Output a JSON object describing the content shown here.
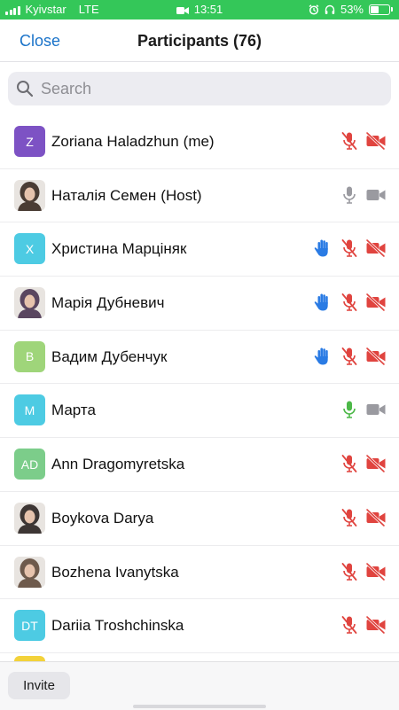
{
  "status_bar": {
    "carrier": "Kyivstar",
    "network": "LTE",
    "time": "13:51",
    "battery": "53%",
    "battery_level": 0.53,
    "icons": [
      "signal-icon",
      "camera-icon",
      "alarm-icon",
      "headphones-icon",
      "battery-icon"
    ]
  },
  "header": {
    "close_label": "Close",
    "title": "Participants (76)"
  },
  "search": {
    "placeholder": "Search"
  },
  "colors": {
    "accent": "#1a73c9",
    "status_bar": "#34c759",
    "muted_red": "#e0443f",
    "mic_active_green": "#4cb848",
    "raised_hand_blue": "#2a7be4",
    "neutral_gray": "#9a9aa0"
  },
  "participants": [
    {
      "name": "Zoriana Haladzhun",
      "role": "(me)",
      "avatar_text": "Z",
      "avatar_color": "#7d52c4",
      "photo": false,
      "hand": false,
      "mic": "muted",
      "video": "off"
    },
    {
      "name": "Наталія Семен",
      "role": "(Host)",
      "avatar_text": "",
      "avatar_color": "#4a3c34",
      "photo": true,
      "hand": false,
      "mic": "idle",
      "video": "idle"
    },
    {
      "name": "Христина Марціняк",
      "role": "",
      "avatar_text": "X",
      "avatar_color": "#4dcbe3",
      "photo": false,
      "hand": true,
      "mic": "muted",
      "video": "off"
    },
    {
      "name": "Марія Дубневич",
      "role": "",
      "avatar_text": "",
      "avatar_color": "#5a4660",
      "photo": true,
      "hand": true,
      "mic": "muted",
      "video": "off"
    },
    {
      "name": "Вадим Дубенчук",
      "role": "",
      "avatar_text": "B",
      "avatar_color": "#9fd57a",
      "photo": false,
      "hand": true,
      "mic": "muted",
      "video": "off"
    },
    {
      "name": "Марта",
      "role": "",
      "avatar_text": "M",
      "avatar_color": "#4dcbe3",
      "photo": false,
      "hand": false,
      "mic": "active",
      "video": "idle"
    },
    {
      "name": "Ann Dragomyretska",
      "role": "",
      "avatar_text": "AD",
      "avatar_color": "#7ccd8a",
      "photo": false,
      "hand": false,
      "mic": "muted",
      "video": "off"
    },
    {
      "name": "Boykova Darya",
      "role": "",
      "avatar_text": "",
      "avatar_color": "#3d3634",
      "photo": true,
      "hand": false,
      "mic": "muted",
      "video": "off"
    },
    {
      "name": "Bozhena Ivanytska",
      "role": "",
      "avatar_text": "",
      "avatar_color": "#6e5a4c",
      "photo": true,
      "hand": false,
      "mic": "muted",
      "video": "off"
    },
    {
      "name": "Dariia Troshchinska",
      "role": "",
      "avatar_text": "DT",
      "avatar_color": "#4dcbe3",
      "photo": false,
      "hand": false,
      "mic": "muted",
      "video": "off"
    }
  ],
  "footer": {
    "invite_label": "Invite"
  }
}
